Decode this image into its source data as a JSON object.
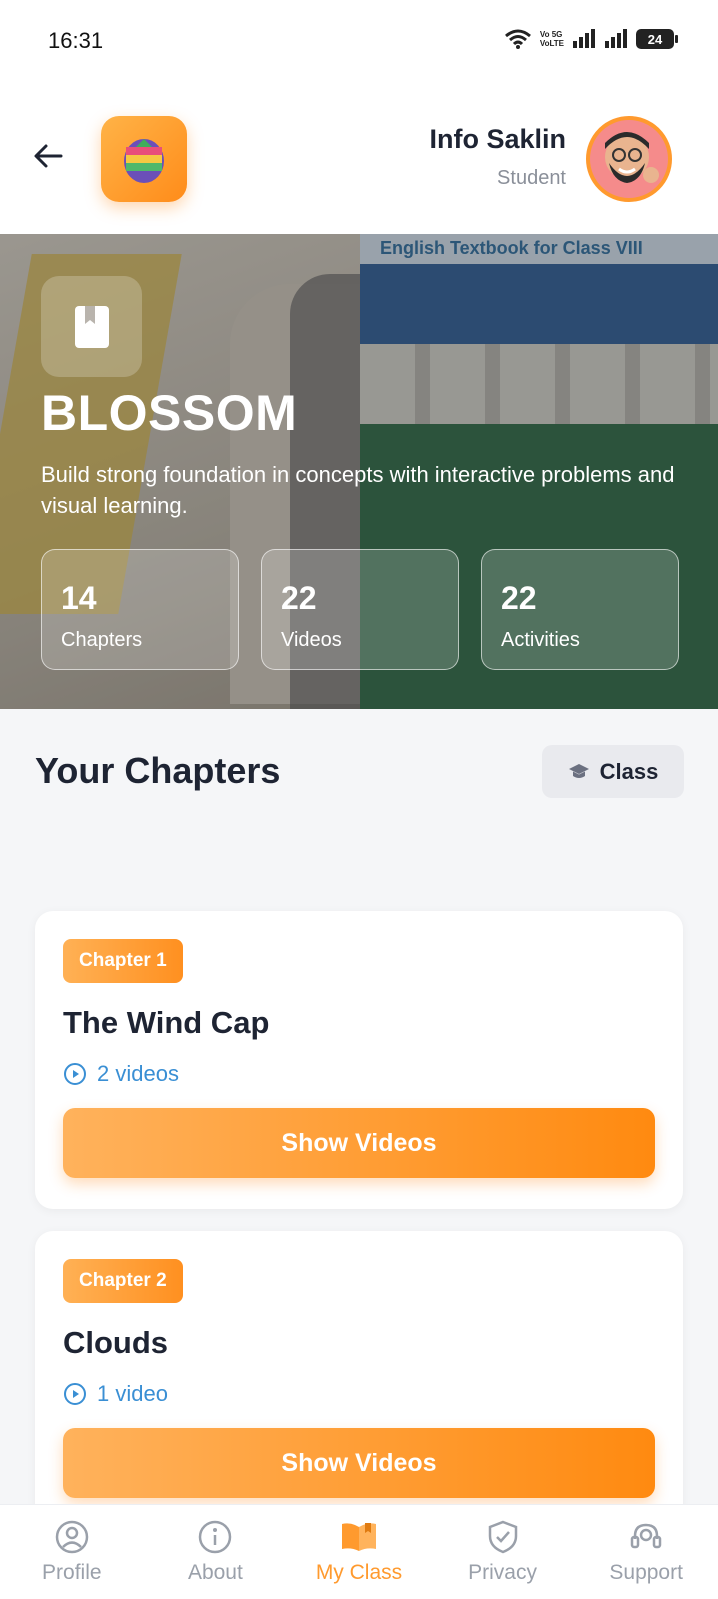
{
  "status_bar": {
    "time": "16:31",
    "network_label_top": "Vo 5G",
    "network_label_bottom": "VoLTE",
    "battery": "24"
  },
  "header": {
    "user_name": "Info Saklin",
    "user_role": "Student"
  },
  "hero": {
    "background_caption": "English Textbook for Class VIII",
    "title": "BLOSSOM",
    "description": "Build strong foundation in concepts with interactive problems and visual learning.",
    "stats": [
      {
        "value": "14",
        "label": "Chapters"
      },
      {
        "value": "22",
        "label": "Videos"
      },
      {
        "value": "22",
        "label": "Activities"
      }
    ]
  },
  "chapters_section": {
    "title": "Your Chapters",
    "class_button_label": "Class"
  },
  "chapters": [
    {
      "badge": "Chapter 1",
      "title": "The Wind Cap",
      "videos": "2 videos",
      "button": "Show Videos"
    },
    {
      "badge": "Chapter 2",
      "title": "Clouds",
      "videos": "1 video",
      "button": "Show Videos"
    }
  ],
  "bottom_nav": {
    "items": [
      {
        "label": "Profile",
        "icon": "profile-icon"
      },
      {
        "label": "About",
        "icon": "info-icon"
      },
      {
        "label": "My Class",
        "icon": "book-open-icon"
      },
      {
        "label": "Privacy",
        "icon": "shield-check-icon"
      },
      {
        "label": "Support",
        "icon": "headset-icon"
      }
    ],
    "active": "My Class"
  },
  "colors": {
    "accent": "#ff9a2e",
    "link_blue": "#3a8fd4",
    "text_dark": "#1e2433",
    "muted": "#9aa0aa"
  }
}
